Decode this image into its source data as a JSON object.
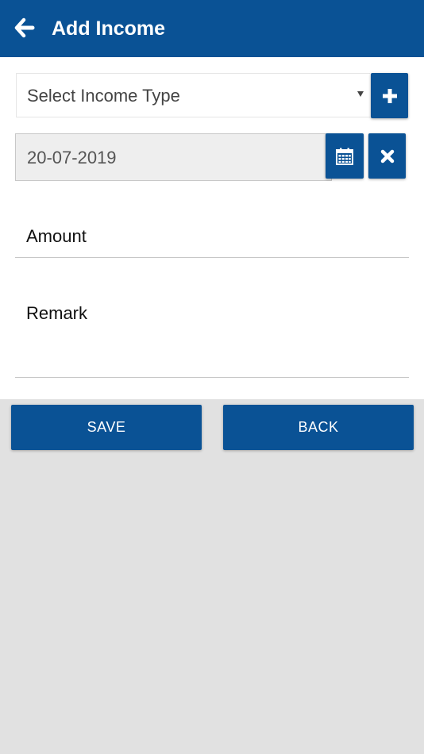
{
  "header": {
    "title": "Add Income",
    "back_icon": "arrow-left-icon",
    "background": "#0a5295"
  },
  "form": {
    "income_type": {
      "selected": "Select Income Type",
      "caret_icon": "caret-down-icon",
      "add_icon": "plus-icon"
    },
    "date": {
      "value": "20-07-2019",
      "calendar_icon": "calendar-icon",
      "clear_icon": "close-icon"
    },
    "amount": {
      "placeholder": "Amount"
    },
    "remark": {
      "placeholder": "Remark"
    }
  },
  "actions": {
    "save_label": "SAVE",
    "back_label": "BACK"
  },
  "colors": {
    "primary": "#0a5295",
    "page_background": "#e1e1e1",
    "form_background": "#ffffff"
  }
}
